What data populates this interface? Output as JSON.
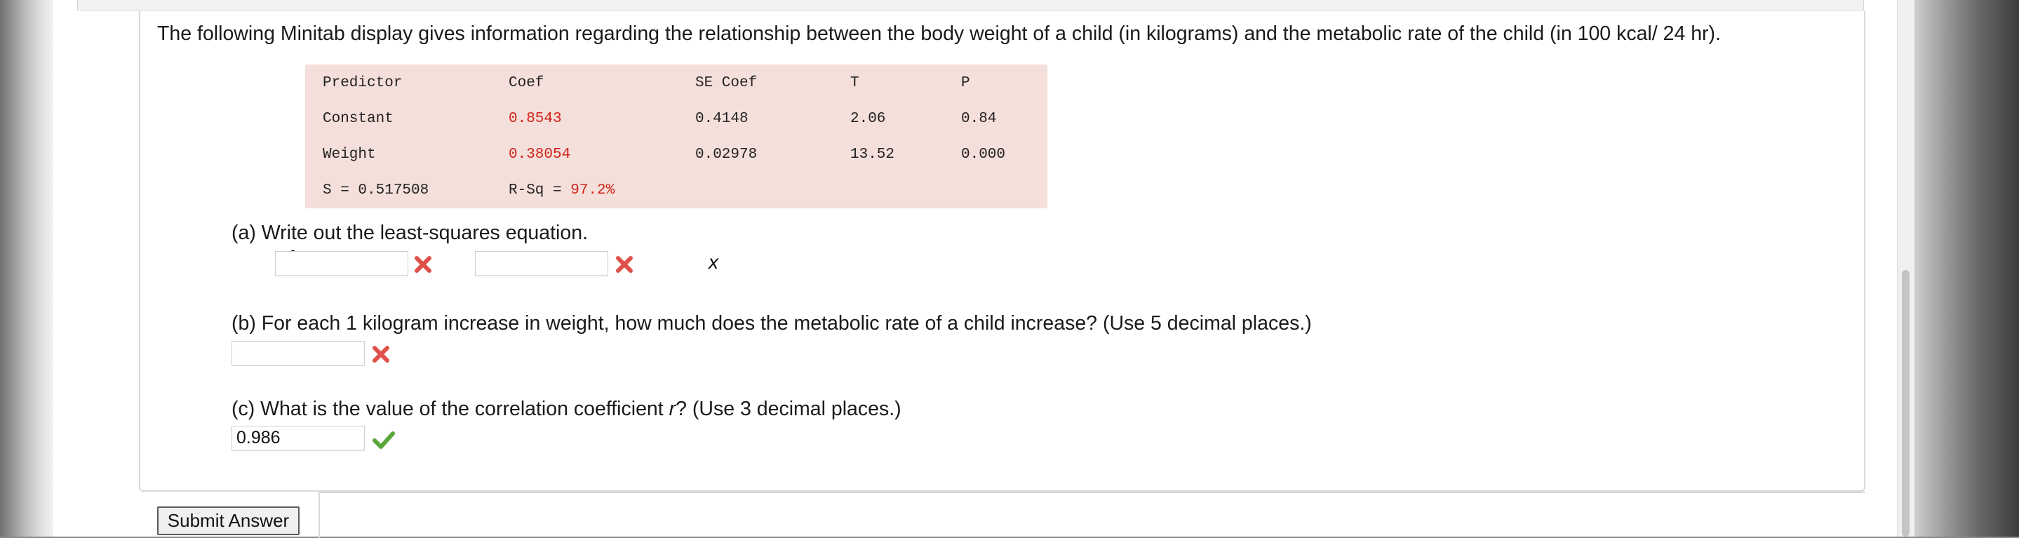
{
  "question_text": "The following Minitab display gives information regarding the relationship between the body weight of a child (in kilograms) and the metabolic rate of the child (in 100 kcal/ 24 hr).",
  "minitab": {
    "headers": [
      "Predictor",
      "Coef",
      "SE Coef",
      "T",
      "P"
    ],
    "rows": [
      [
        "Constant",
        "0.8543",
        "0.4148",
        "2.06",
        "0.84"
      ],
      [
        "Weight",
        "0.38054",
        "0.02978",
        "13.52",
        "0.000"
      ]
    ],
    "s_label": "S = 0.517508",
    "rsq_label": "R-Sq = ",
    "rsq_value": "97.2%"
  },
  "part_a": {
    "prompt": "(a) Write out the least-squares equation.",
    "yhat": "ŷ =",
    "plus": "+",
    "x": "x",
    "intercept_value": "",
    "slope_value": "",
    "intercept_status": "incorrect",
    "slope_status": "incorrect"
  },
  "part_b": {
    "prompt": "(b) For each 1 kilogram increase in weight, how much does the metabolic rate of a child increase? (Use 5 decimal places.)",
    "value": "",
    "status": "incorrect"
  },
  "part_c": {
    "prompt_before": "(c) What is the value of the correlation coefficient ",
    "prompt_var": "r",
    "prompt_after": "? (Use 3 decimal places.)",
    "value": "0.986",
    "status": "correct"
  },
  "submit_label": "Submit Answer",
  "colors": {
    "highlight_red": "#d0241a",
    "table_bg": "#f5dfdb",
    "incorrect": "#e0504a",
    "correct": "#5aa63a"
  },
  "icons": {
    "incorrect": "x-mark-icon",
    "correct": "check-mark-icon"
  }
}
